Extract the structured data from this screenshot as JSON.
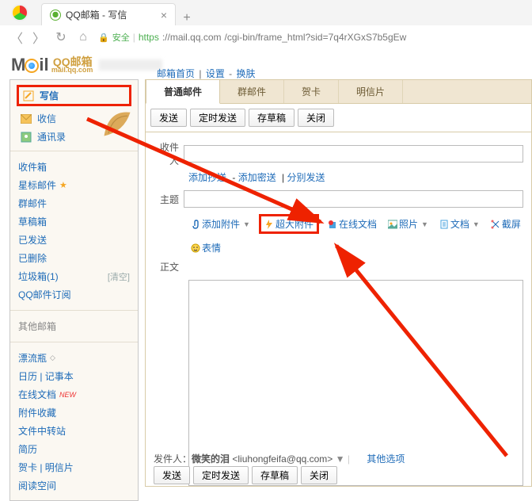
{
  "browser": {
    "tab_title": "QQ邮箱 - 写信",
    "url_secure": "安全",
    "url_https": "https",
    "url_host": "://mail.qq.com",
    "url_path": "/cgi-bin/frame_html?sid=7q4rXGxS7b5gEw"
  },
  "logo": {
    "cn": "QQ邮箱",
    "sub": "mail.qq.com"
  },
  "headlinks": {
    "home": "邮箱首页",
    "settings": "设置",
    "skin": "换肤"
  },
  "sidebar": {
    "compose": "写信",
    "inbox": "收信",
    "contacts": "通讯录",
    "folders": {
      "inbox": "收件箱",
      "starred": "星标邮件",
      "group": "群邮件",
      "drafts": "草稿箱",
      "sent": "已发送",
      "deleted": "已删除",
      "spam": "垃圾箱(1)",
      "spam_clear": "[清空]",
      "sub": "QQ邮件订阅"
    },
    "other_header": "其他邮箱",
    "extras": {
      "drift": "漂流瓶",
      "calendar": "日历 | 记事本",
      "docs": "在线文档",
      "fav": "附件收藏",
      "transfer": "文件中转站",
      "resume": "简历",
      "cards": "贺卡 | 明信片",
      "readspace": "阅读空间"
    }
  },
  "main": {
    "tabs": {
      "normal": "普通邮件",
      "group": "群邮件",
      "greeting": "贺卡",
      "postcard": "明信片"
    },
    "toolbar": {
      "send": "发送",
      "timed": "定时发送",
      "draft": "存草稿",
      "close": "关闭"
    },
    "labels": {
      "to": "收件人",
      "subject": "主题",
      "body": "正文"
    },
    "sublinks": {
      "cc": "添加抄送",
      "bcc": "添加密送",
      "sep": "分别发送"
    },
    "attach": {
      "add": "添加附件",
      "large": "超大附件",
      "docs": "在线文档",
      "photo": "照片",
      "doc": "文档",
      "shot": "截屏",
      "emoji": "表情"
    },
    "sender_label": "发件人：",
    "sender_name": "微笑的泪",
    "sender_email": "<liuhongfeifa@qq.com>",
    "other_options": "其他选项"
  }
}
